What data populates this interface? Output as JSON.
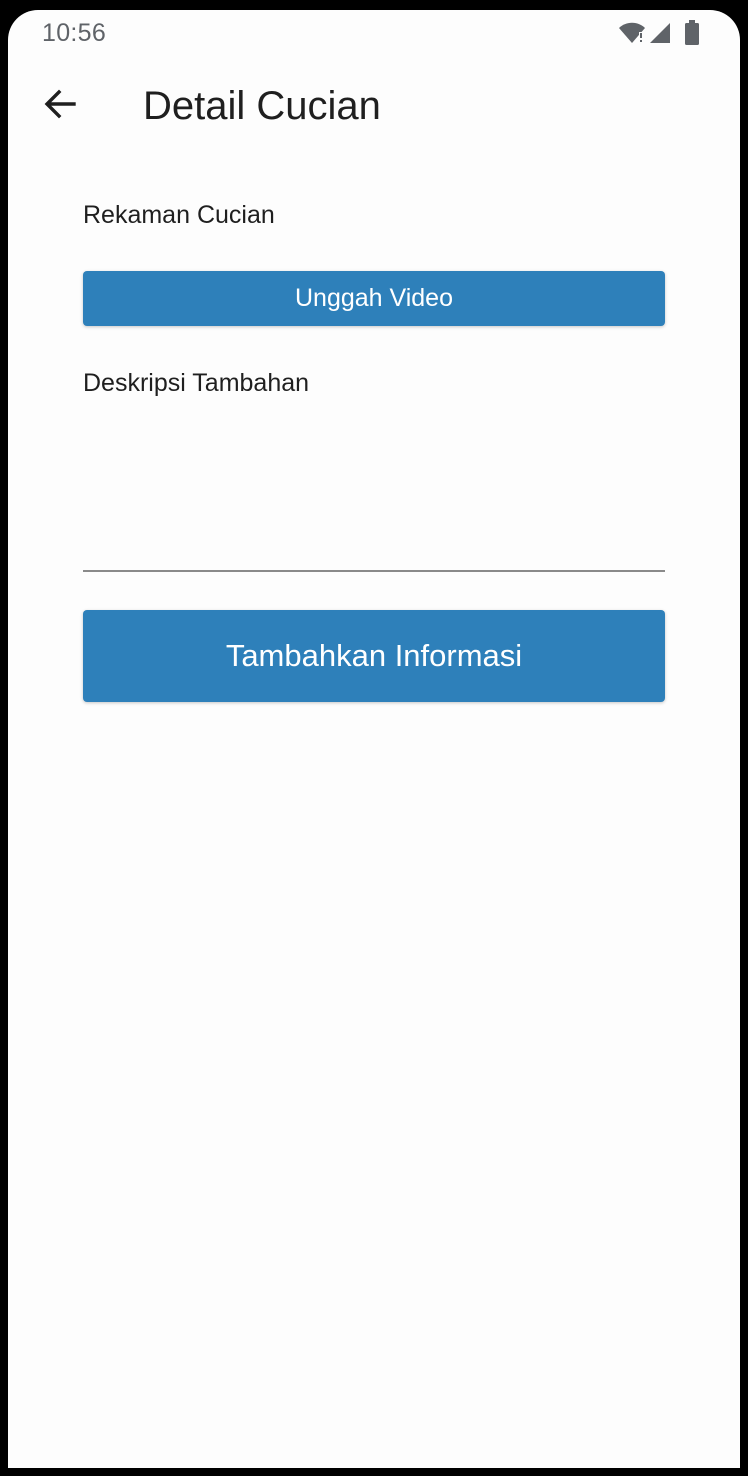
{
  "status_bar": {
    "time": "10:56",
    "icons": [
      "wifi-alert-icon",
      "cell-signal-icon",
      "battery-icon"
    ]
  },
  "app_bar": {
    "back_icon": "arrow-left-icon",
    "title": "Detail Cucian"
  },
  "form": {
    "recording_label": "Rekaman Cucian",
    "upload_button_label": "Unggah Video",
    "description_label": "Deskripsi Tambahan",
    "description_value": "",
    "submit_button_label": "Tambahkan Informasi"
  },
  "colors": {
    "primary": "#2e80ba",
    "background": "#fdfdfd",
    "text": "#1f1f1f",
    "underline": "#8a8a8a"
  }
}
